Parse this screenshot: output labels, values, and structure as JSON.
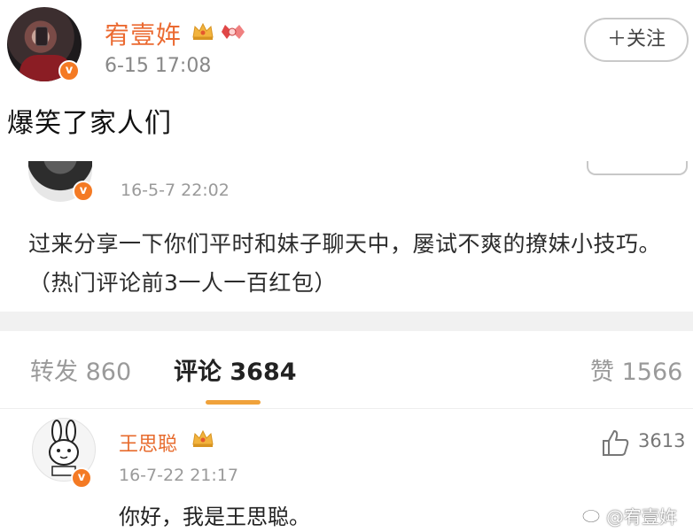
{
  "post": {
    "username": "宥壹姩",
    "timestamp": "6-15 17:08",
    "follow_label": "＋关注",
    "text": "爆笑了家人们"
  },
  "embedded": {
    "original_post": {
      "timestamp": "16-5-7 22:02",
      "text": "过来分享一下你们平时和妹子聊天中，屡试不爽的撩妹小技巧。（热门评论前3一人一百红包）"
    },
    "tabs": [
      {
        "label": "转发 860"
      },
      {
        "label": "评论 3684"
      },
      {
        "label": "赞 1566"
      }
    ],
    "comment": {
      "name": "王思聪",
      "timestamp": "16-7-22 21:17",
      "text": "你好，我是王思聪。",
      "likes": "3613"
    }
  },
  "watermark": "@宥壹姩",
  "colors": {
    "username": "#eb6a31",
    "verified_badge": "#f47a24",
    "tab_underline": "#f0a23b"
  },
  "icons": [
    "crown-icon",
    "verified-badge-icon",
    "like-thumb-icon",
    "weibo-logo-icon"
  ]
}
